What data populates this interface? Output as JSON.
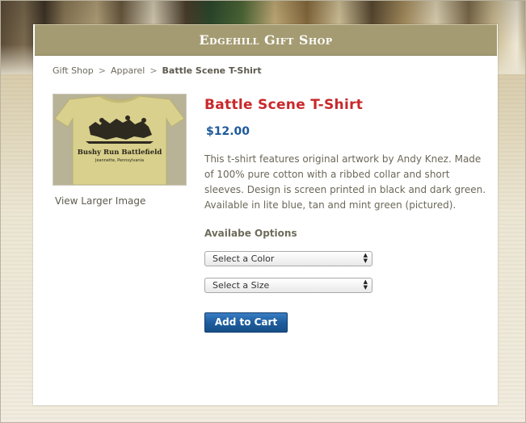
{
  "shop": {
    "title": "Edgehill Gift Shop"
  },
  "breadcrumb": {
    "items": [
      "Gift Shop",
      "Apparel"
    ],
    "separator": ">",
    "current": "Battle Scene T-Shirt"
  },
  "product": {
    "title": "Battle Scene T-Shirt",
    "price": "$12.00",
    "description": "This t-shirt features original artwork by Andy Knez. Made of 100% pure cotton with a ribbed collar and short sleeves. Design is screen printed in black and dark green. Available in lite blue, tan and mint green (pictured).",
    "image_link": "View Larger Image",
    "shirt_print": {
      "line1": "Bushy Run Battlefield",
      "line2": "Jeannette, Pennsylvania"
    }
  },
  "options": {
    "heading": "Availabe Options",
    "color_select": "Select a Color",
    "size_select": "Select a Size"
  },
  "cart": {
    "button": "Add to Cart"
  },
  "colors": {
    "header_bar": "#a49b72",
    "title_red": "#c8282b",
    "price_blue": "#1e5a9a",
    "button_blue": "#1e5d9e",
    "shirt_tan": "#d8d08c"
  }
}
